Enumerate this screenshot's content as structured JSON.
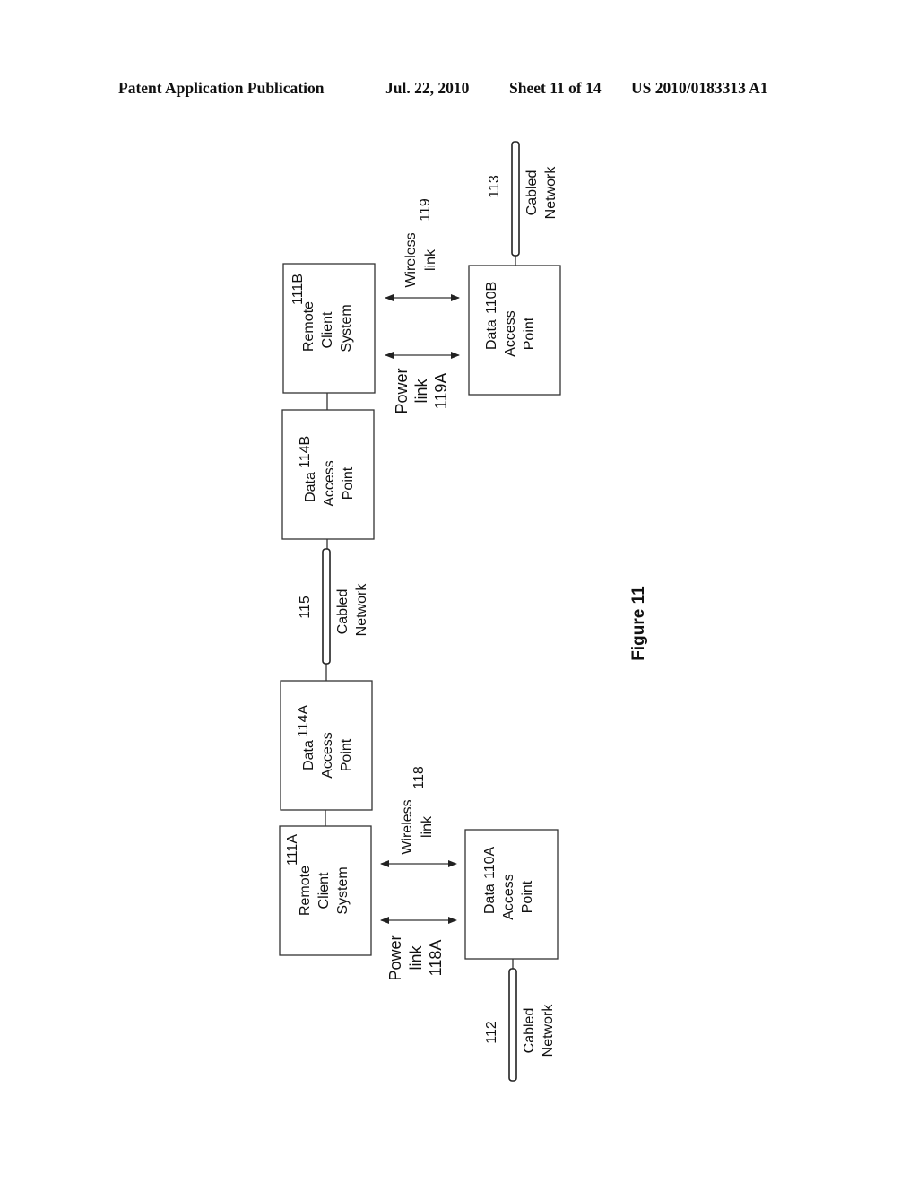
{
  "header": {
    "publication": "Patent Application Publication",
    "date": "Jul. 22, 2010",
    "sheet": "Sheet 11 of 14",
    "number": "US 2010/0183313 A1"
  },
  "figure": {
    "caption": "Figure 11",
    "nodes": {
      "rcs_b": {
        "ref": "111B",
        "lines": [
          "Remote",
          "Client",
          "System"
        ]
      },
      "dap_110b": {
        "ref": "110B",
        "lines": [
          "Data",
          "Access",
          "Point"
        ]
      },
      "dap_114b": {
        "ref": "114B",
        "lines": [
          "Data",
          "Access",
          "Point"
        ]
      },
      "dap_114a": {
        "ref": "114A",
        "lines": [
          "Data",
          "Access",
          "Point"
        ]
      },
      "rcs_a": {
        "ref": "111A",
        "lines": [
          "Remote",
          "Client",
          "System"
        ]
      },
      "dap_110a": {
        "ref": "110A",
        "lines": [
          "Data",
          "Access",
          "Point"
        ]
      }
    },
    "networks": {
      "net_113": {
        "ref": "113",
        "lines": [
          "Cabled",
          "Network"
        ]
      },
      "net_115": {
        "ref": "115",
        "lines": [
          "Cabled",
          "Network"
        ]
      },
      "net_112": {
        "ref": "112",
        "lines": [
          "Cabled",
          "Network"
        ]
      }
    },
    "links": {
      "wireless_119": {
        "ref": "119",
        "lines": [
          "Wireless",
          "link"
        ]
      },
      "power_119a": {
        "lines": [
          "Power",
          "link",
          "119A"
        ]
      },
      "wireless_118": {
        "ref": "118",
        "lines": [
          "Wireless",
          "link"
        ]
      },
      "power_118a": {
        "lines": [
          "Power",
          "link",
          "118A"
        ]
      }
    }
  }
}
